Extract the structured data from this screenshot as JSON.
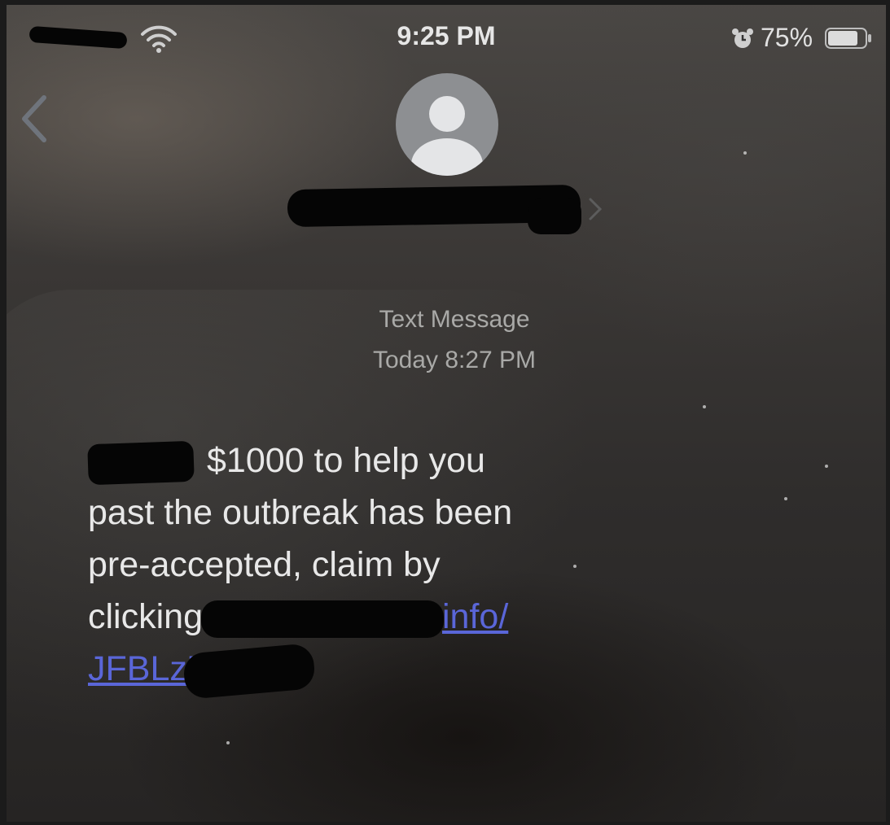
{
  "status_bar": {
    "time": "9:25 PM",
    "battery_percent": "75%",
    "icons": [
      "wifi-icon",
      "alarm-icon",
      "battery-icon"
    ]
  },
  "header": {
    "avatar_icon": "person-placeholder-icon",
    "back_icon": "chevron-left-icon"
  },
  "meta": {
    "label": "Text Message",
    "timestamp": "Today 8:27 PM"
  },
  "message": {
    "line1": "$1000 to help you",
    "line2": "past the outbreak has been",
    "line3": "pre-accepted, claim by",
    "line4_text": "clicking",
    "line4_link": "info/",
    "line5_link": "JFBLzZ"
  },
  "colors": {
    "link": "#5a66d8",
    "text": "#e8e8e8",
    "meta": "#a9a9a7"
  }
}
